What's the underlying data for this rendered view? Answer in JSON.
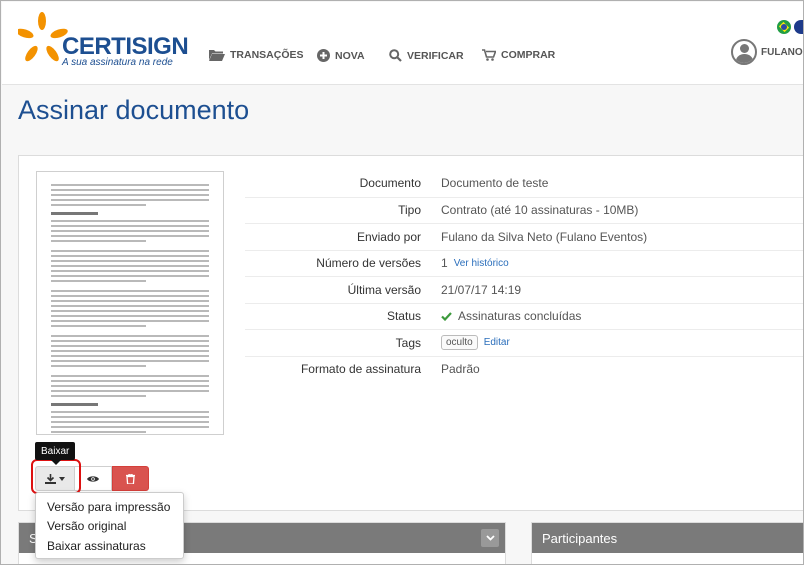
{
  "brand": {
    "name": "CERTISIGN",
    "tagline": "A sua assinatura na rede"
  },
  "nav": [
    {
      "label": "TRANSAÇÕES",
      "icon": "folder-open-icon"
    },
    {
      "label": "NOVA",
      "icon": "plus-circle-icon"
    },
    {
      "label": "VERIFICAR",
      "icon": "search-icon"
    },
    {
      "label": "COMPRAR",
      "icon": "cart-icon"
    }
  ],
  "user": {
    "name": "FULANO"
  },
  "page": {
    "title": "Assinar documento"
  },
  "details": {
    "documento": {
      "label": "Documento",
      "value": "Documento de teste"
    },
    "tipo": {
      "label": "Tipo",
      "value": "Contrato (até 10 assinaturas - 10MB)"
    },
    "enviado": {
      "label": "Enviado por",
      "value": "Fulano da Silva Neto (Fulano Eventos)"
    },
    "versoes": {
      "label": "Número de versões",
      "value": "1",
      "link": "Ver histórico"
    },
    "ultima": {
      "label": "Última versão",
      "value": "21/07/17 14:19"
    },
    "status": {
      "label": "Status",
      "value": "Assinaturas concluídas"
    },
    "tags": {
      "label": "Tags",
      "tag": "oculto",
      "link": "Editar"
    },
    "formato": {
      "label": "Formato de assinatura",
      "value": "Padrão"
    }
  },
  "actions": {
    "tooltip": "Baixar"
  },
  "dropdown": [
    "Versão para impressão",
    "Versão original",
    "Baixar assinaturas"
  ],
  "panels": {
    "left_title": "S",
    "right_title": "Participantes"
  },
  "colors": {
    "brand_blue": "#1d4f91",
    "brand_orange": "#f39200",
    "danger": "#d9534f",
    "success": "#3c9a3c",
    "link": "#2a6ebb"
  }
}
